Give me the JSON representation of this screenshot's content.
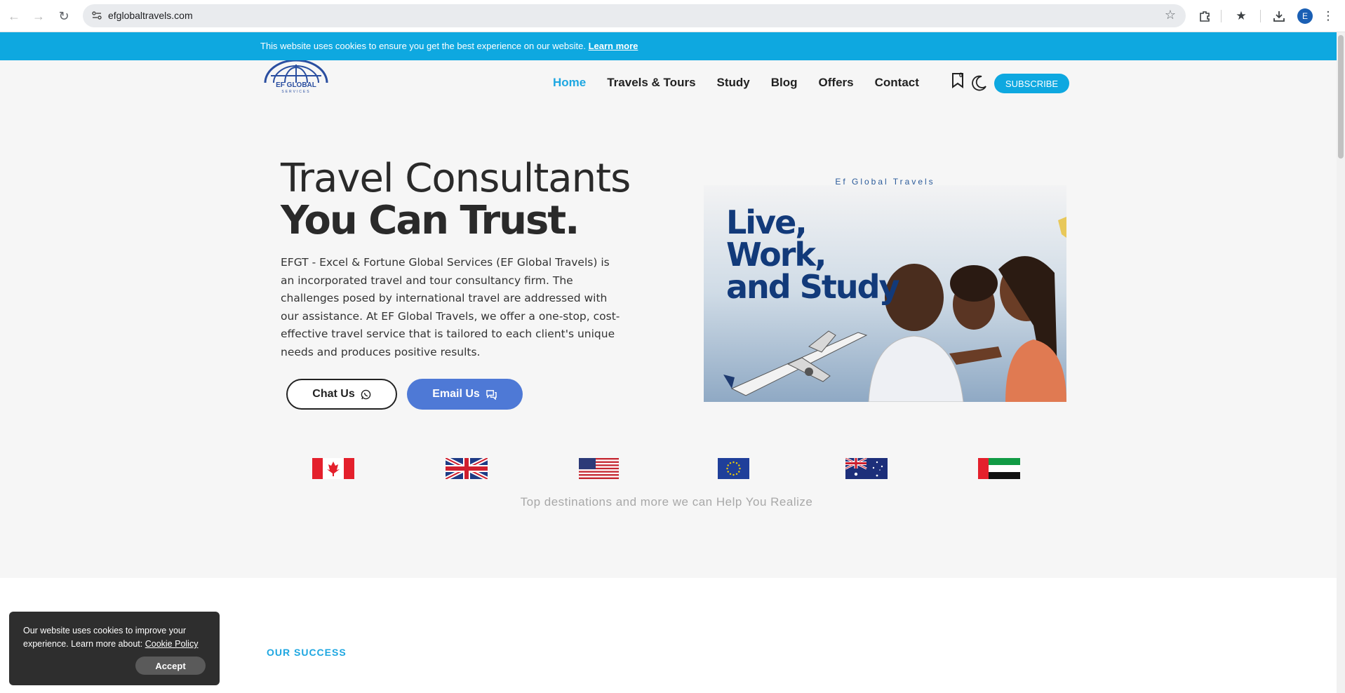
{
  "browser": {
    "url": "efglobaltravels.com",
    "profile_initial": "E"
  },
  "cookie_bar": {
    "message": "This website uses cookies to ensure you get the best experience on our website.",
    "link_label": "Learn more"
  },
  "header": {
    "logo_text": "EF GLOBAL",
    "logo_subtext": "SERVICES",
    "nav": [
      {
        "label": "Home",
        "active": true
      },
      {
        "label": "Travels & Tours"
      },
      {
        "label": "Study"
      },
      {
        "label": "Blog"
      },
      {
        "label": "Offers"
      },
      {
        "label": "Contact"
      }
    ],
    "bookmark_count": "0",
    "subscribe_label": "SUBSCRIBE"
  },
  "hero": {
    "title_line1": "Travel Consultants",
    "title_line2": "You Can Trust.",
    "description": "EFGT - Excel & Fortune Global Services (EF Global Travels) is an incorporated travel and tour consultancy firm. The challenges posed by international travel are addressed with our assistance. At EF Global Travels, we offer a one-stop, cost-effective travel service that is tailored to each client's unique needs and produces positive results.",
    "chat_label": "Chat Us",
    "email_label": "Email Us",
    "image_caption": "Ef Global Travels",
    "image_headline_1": "Live,",
    "image_headline_2": "Work,",
    "image_headline_3": "and Study"
  },
  "destinations": {
    "flags": [
      "canada-flag",
      "uk-flag",
      "usa-flag",
      "eu-flag",
      "australia-flag",
      "uae-flag"
    ],
    "caption": "Top destinations and more we can Help You Realize"
  },
  "section": {
    "eyebrow": "OUR SUCCESS"
  },
  "cookie_popup": {
    "text": "Our website uses cookies to improve your experience. Learn more about: ",
    "link_label": "Cookie Policy",
    "accept_label": "Accept"
  },
  "colors": {
    "accent": "#0ea8e0",
    "email_button": "#4e79d6",
    "headline_blue": "#123a7a"
  }
}
